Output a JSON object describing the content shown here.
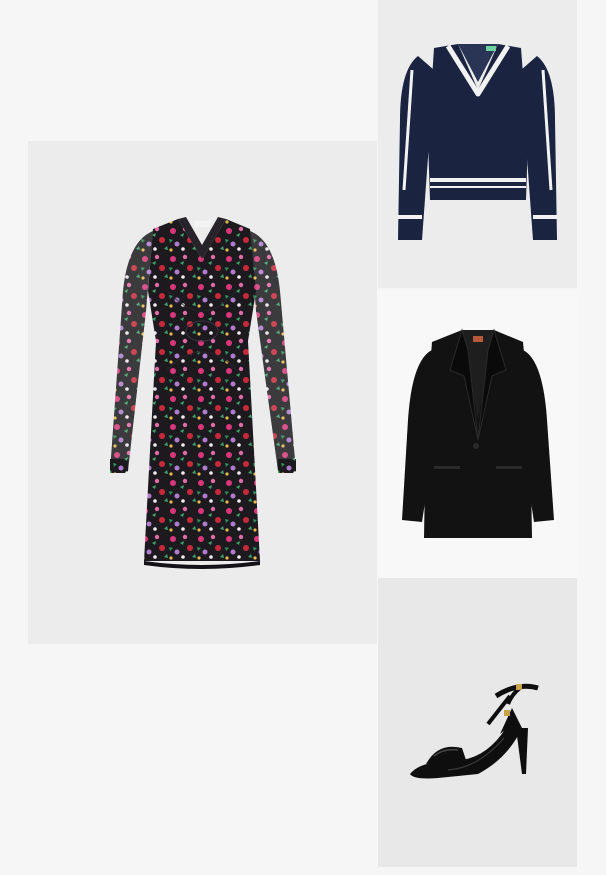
{
  "outfit": {
    "items": [
      {
        "id": "dress",
        "product_type": "floral-mesh-dress-image"
      },
      {
        "id": "sweater",
        "product_type": "navy-cricket-sweater-image"
      },
      {
        "id": "blazer",
        "product_type": "black-blazer-image"
      },
      {
        "id": "sandal",
        "product_type": "black-patent-heeled-sandal-image"
      }
    ]
  },
  "colors": {
    "page_bg": "#f6f6f6",
    "tile_bg": "#ececec",
    "dress_base": "#1c1a1e",
    "sweater_navy": "#1a2440",
    "sweater_trim": "#f2f2f2",
    "blazer_black": "#121212",
    "sandal_black": "#0e0e0e",
    "sandal_buckle": "#c8a24a"
  }
}
